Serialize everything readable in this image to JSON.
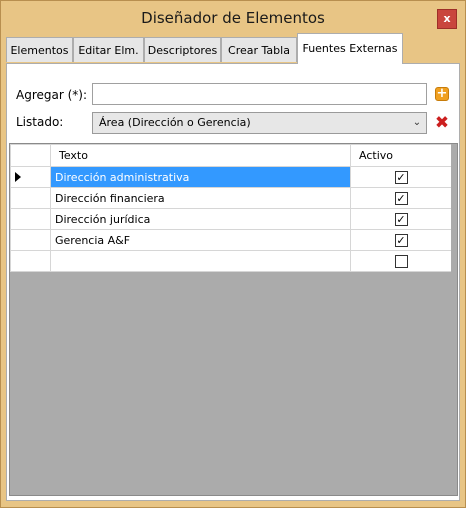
{
  "window": {
    "title": "Diseñador de Elementos",
    "close_label": "x"
  },
  "tabs": [
    {
      "label": "Elementos"
    },
    {
      "label": "Editar Elm."
    },
    {
      "label": "Descriptores"
    },
    {
      "label": "Crear Tabla"
    },
    {
      "label": "Fuentes Externas"
    }
  ],
  "active_tab": "Fuentes Externas",
  "form": {
    "agregar_label": "Agregar (*):",
    "agregar_value": "",
    "listado_label": "Listado:",
    "listado_selected": "Área (Dirección o Gerencia)"
  },
  "grid": {
    "columns": [
      "Texto",
      "Activo"
    ],
    "rows": [
      {
        "texto": "Dirección administrativa",
        "activo": true,
        "selected": true
      },
      {
        "texto": "Dirección financiera",
        "activo": true,
        "selected": false
      },
      {
        "texto": "Dirección jurídica",
        "activo": true,
        "selected": false
      },
      {
        "texto": "Gerencia A&F",
        "activo": true,
        "selected": false
      },
      {
        "texto": "",
        "activo": false,
        "selected": false
      }
    ]
  },
  "colors": {
    "accent": "#e8c585",
    "selection": "#3399ff",
    "close": "#c9463d"
  },
  "icons": {
    "add": "add-icon",
    "delete": "delete-icon",
    "close": "close-icon",
    "dropdown": "chevron-down-icon"
  }
}
